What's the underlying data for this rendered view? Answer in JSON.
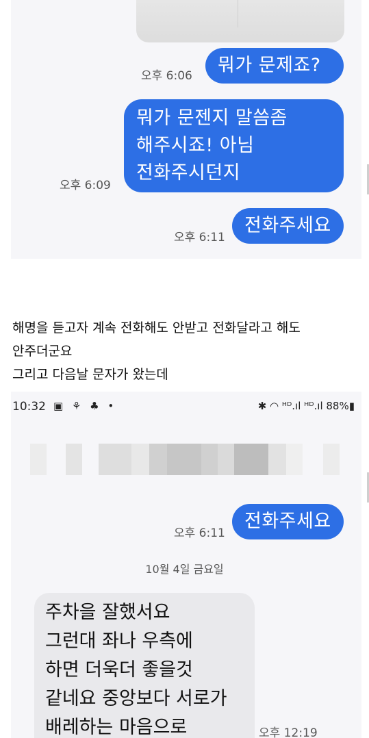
{
  "top_conversation": {
    "messages": [
      {
        "text": "뭐가 문제죠?",
        "time": "오후 6:06"
      },
      {
        "text": "뭐가 문젠지 말씀좀\n해주시죠! 아님\n전화주시던지",
        "time": "오후 6:09"
      },
      {
        "text": "전화주세요",
        "time": "오후 6:11"
      }
    ]
  },
  "caption": {
    "line1": "해명을 듣고자 계속 전화해도 안받고 전화달라고 해도",
    "line2": "안주더군요",
    "line3": "그리고 다음날 문자가 왔는데"
  },
  "bottom_screenshot": {
    "status_time": "10:32",
    "status_icons_left": "▣ ⚘ ♣ •",
    "status_right": "✱ ◠ ᴴᴰ.ıl ᴴᴰ.ıl 88%▮",
    "battery": "88%",
    "sent_message": {
      "text": "전화주세요",
      "time": "오후 6:11"
    },
    "date_separator": "10월 4일 금요일",
    "received_message": {
      "text": "주차을 잘했서요\n그런대 좌나 우측에\n하면  더욱더 좋을것\n같네요 중앙보다 서로가\n배레하는 마음으로",
      "time": "오후 12:19"
    }
  },
  "colors": {
    "sent_bubble": "#2d6fe5",
    "received_bubble": "#e9e9ec",
    "panel_bg": "#f6f6f9"
  }
}
